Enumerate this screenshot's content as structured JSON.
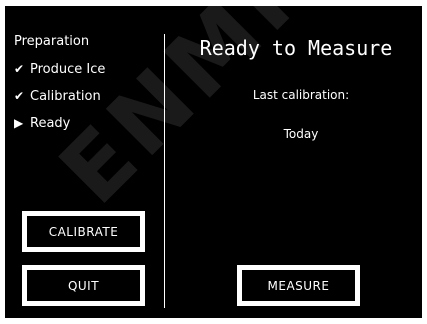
{
  "colors": {
    "background": "#000000",
    "foreground": "#ffffff"
  },
  "sidebar": {
    "title": "Preparation",
    "steps": [
      {
        "icon": "check-icon",
        "mark": "✔",
        "label": "Produce Ice"
      },
      {
        "icon": "check-icon",
        "mark": "✔",
        "label": "Calibration"
      },
      {
        "icon": "current-step-arrow-icon",
        "mark": "▶",
        "label": "Ready"
      }
    ]
  },
  "main": {
    "headline": "Ready to Measure",
    "calibration_label": "Last calibration:",
    "calibration_value": "Today"
  },
  "buttons": {
    "calibrate": "CALIBRATE",
    "quit": "QUIT",
    "measure": "MEASURE"
  },
  "watermark": "ENMIN"
}
